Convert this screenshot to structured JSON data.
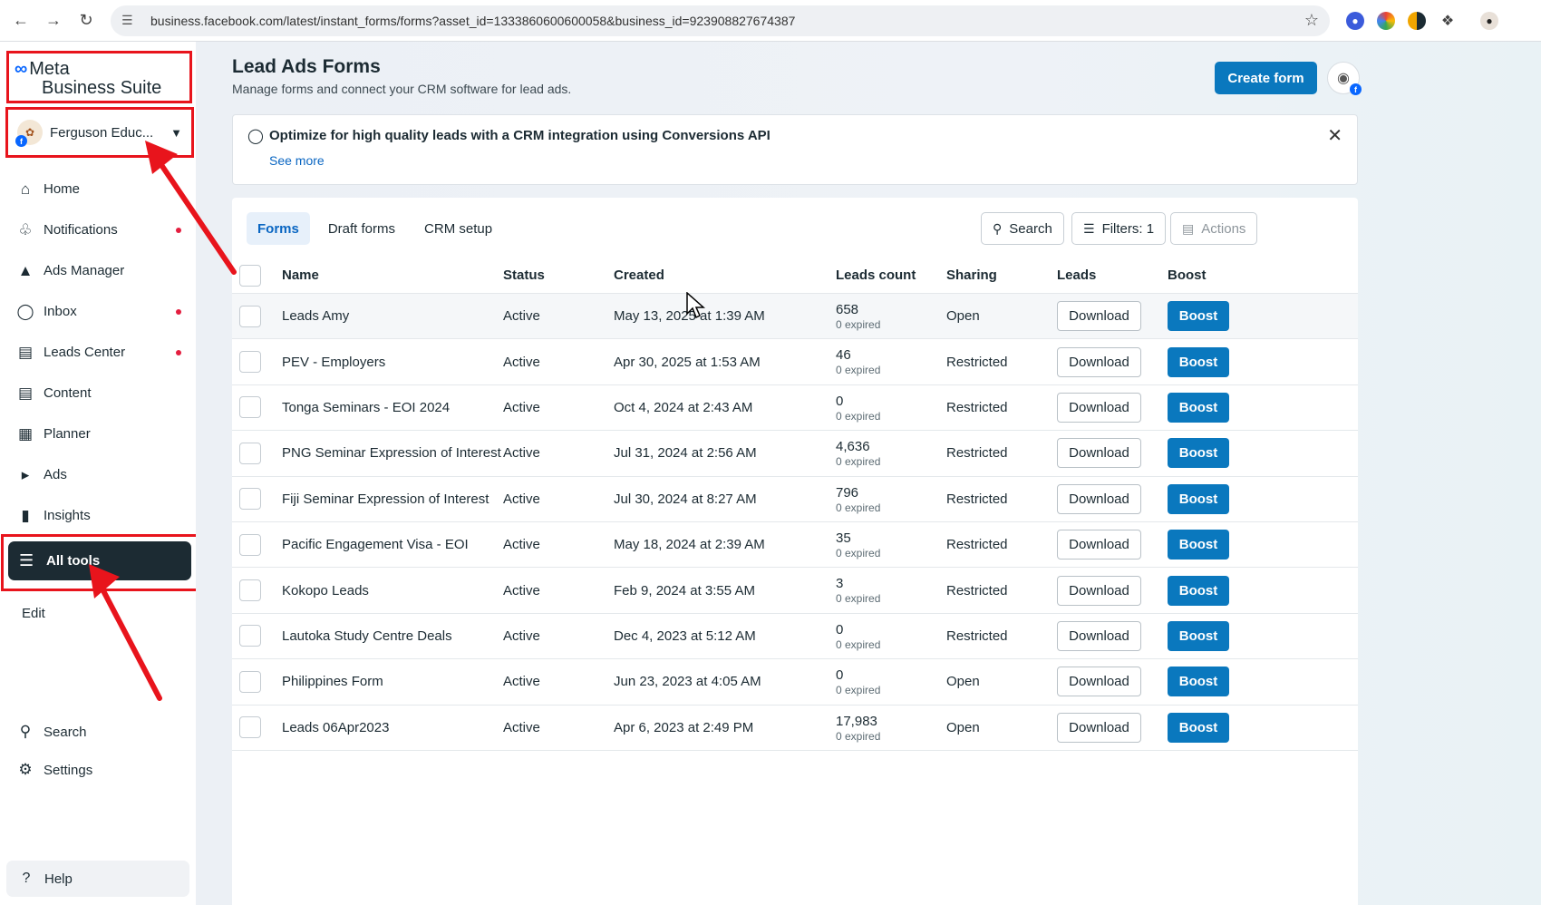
{
  "browser": {
    "url": "business.facebook.com/latest/instant_forms/forms?asset_id=1333860600600058&business_id=923908827674387"
  },
  "sidebar": {
    "logo_line1": "Meta",
    "logo_line2": "Business Suite",
    "account_name": "Ferguson Educ...",
    "items": [
      {
        "label": "Home",
        "icon": "home-icon",
        "dot": false
      },
      {
        "label": "Notifications",
        "icon": "bell-icon",
        "dot": true
      },
      {
        "label": "Ads Manager",
        "icon": "ads-manager-icon",
        "dot": false
      },
      {
        "label": "Inbox",
        "icon": "inbox-icon",
        "dot": true
      },
      {
        "label": "Leads Center",
        "icon": "leads-center-icon",
        "dot": true
      },
      {
        "label": "Content",
        "icon": "content-icon",
        "dot": false
      },
      {
        "label": "Planner",
        "icon": "planner-icon",
        "dot": false
      },
      {
        "label": "Ads",
        "icon": "megaphone-icon",
        "dot": false
      },
      {
        "label": "Insights",
        "icon": "insights-icon",
        "dot": false
      }
    ],
    "all_tools": "All tools",
    "edit": "Edit",
    "search": "Search",
    "settings": "Settings",
    "help": "Help"
  },
  "header": {
    "title": "Lead Ads Forms",
    "subtitle": "Manage forms and connect your CRM software for lead ads.",
    "create_button": "Create form"
  },
  "banner": {
    "title": "Optimize for high quality leads with a CRM integration using Conversions API",
    "link": "See more"
  },
  "tabs": [
    {
      "label": "Forms",
      "active": true
    },
    {
      "label": "Draft forms",
      "active": false
    },
    {
      "label": "CRM setup",
      "active": false
    }
  ],
  "toolbar": {
    "search": "Search",
    "filters": "Filters: 1",
    "actions": "Actions"
  },
  "table": {
    "columns": [
      "Name",
      "Status",
      "Created",
      "Leads count",
      "Sharing",
      "Leads",
      "Boost"
    ],
    "download_label": "Download",
    "boost_label": "Boost",
    "rows": [
      {
        "name": "Leads Amy",
        "status": "Active",
        "created": "May 13, 2025 at 1:39 AM",
        "count": "658",
        "expired": "0 expired",
        "sharing": "Open"
      },
      {
        "name": "PEV - Employers",
        "status": "Active",
        "created": "Apr 30, 2025 at 1:53 AM",
        "count": "46",
        "expired": "0 expired",
        "sharing": "Restricted"
      },
      {
        "name": "Tonga Seminars - EOI 2024",
        "status": "Active",
        "created": "Oct 4, 2024 at 2:43 AM",
        "count": "0",
        "expired": "0 expired",
        "sharing": "Restricted"
      },
      {
        "name": "PNG Seminar Expression of Interest",
        "status": "Active",
        "created": "Jul 31, 2024 at 2:56 AM",
        "count": "4,636",
        "expired": "0 expired",
        "sharing": "Restricted"
      },
      {
        "name": "Fiji Seminar Expression of Interest",
        "status": "Active",
        "created": "Jul 30, 2024 at 8:27 AM",
        "count": "796",
        "expired": "0 expired",
        "sharing": "Restricted"
      },
      {
        "name": "Pacific Engagement Visa - EOI",
        "status": "Active",
        "created": "May 18, 2024 at 2:39 AM",
        "count": "35",
        "expired": "0 expired",
        "sharing": "Restricted"
      },
      {
        "name": "Kokopo Leads",
        "status": "Active",
        "created": "Feb 9, 2024 at 3:55 AM",
        "count": "3",
        "expired": "0 expired",
        "sharing": "Restricted"
      },
      {
        "name": "Lautoka Study Centre Deals",
        "status": "Active",
        "created": "Dec 4, 2023 at 5:12 AM",
        "count": "0",
        "expired": "0 expired",
        "sharing": "Restricted"
      },
      {
        "name": "Philippines Form",
        "status": "Active",
        "created": "Jun 23, 2023 at 4:05 AM",
        "count": "0",
        "expired": "0 expired",
        "sharing": "Open"
      },
      {
        "name": "Leads 06Apr2023",
        "status": "Active",
        "created": "Apr 6, 2023 at 2:49 PM",
        "count": "17,983",
        "expired": "0 expired",
        "sharing": "Open"
      }
    ]
  },
  "colors": {
    "accent": "#0a78be",
    "annotation": "#e8141c",
    "sidebar_active": "#1c2b33"
  }
}
